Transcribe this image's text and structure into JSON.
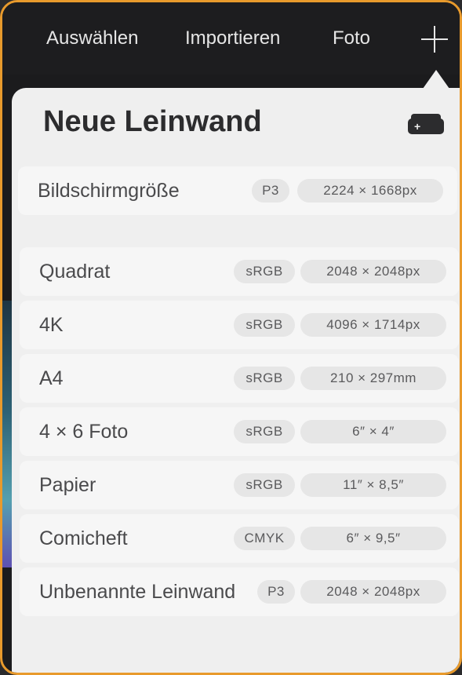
{
  "toolbar": {
    "select_label": "Auswählen",
    "import_label": "Importieren",
    "photo_label": "Foto"
  },
  "panel": {
    "title": "Neue Leinwand"
  },
  "rows": [
    {
      "name": "Bildschirmgröße",
      "color_space": "P3",
      "dimensions": "2224 × 1668px"
    },
    {
      "name": "Quadrat",
      "color_space": "sRGB",
      "dimensions": "2048 × 2048px"
    },
    {
      "name": "4K",
      "color_space": "sRGB",
      "dimensions": "4096 × 1714px"
    },
    {
      "name": "A4",
      "color_space": "sRGB",
      "dimensions": "210 × 297mm"
    },
    {
      "name": "4 × 6 Foto",
      "color_space": "sRGB",
      "dimensions": "6″ × 4″"
    },
    {
      "name": "Papier",
      "color_space": "sRGB",
      "dimensions": "11″ × 8,5″"
    },
    {
      "name": "Comicheft",
      "color_space": "CMYK",
      "dimensions": "6″ × 9,5″"
    },
    {
      "name": "Unbenannte Leinwand",
      "color_space": "P3",
      "dimensions": "2048 × 2048px"
    }
  ]
}
